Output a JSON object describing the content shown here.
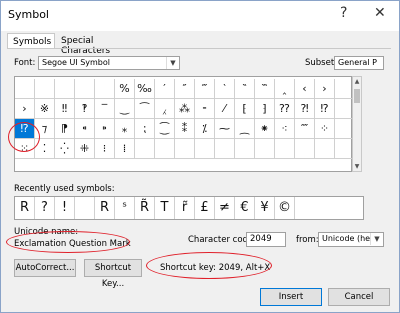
{
  "window": {
    "title": "Symbol",
    "help_glyph": "?",
    "close_glyph": "✕"
  },
  "tabs": [
    {
      "label": "Symbols",
      "active": true
    },
    {
      "label": "Special Characters",
      "active": false
    }
  ],
  "font": {
    "label": "Font:",
    "value": "Segoe UI Symbol"
  },
  "subset": {
    "label": "Subset:",
    "value": "General P"
  },
  "grid": [
    [
      "",
      "",
      "",
      "",
      "",
      "%",
      "‰",
      "′",
      "″",
      "‴",
      "‵",
      "‶",
      "‷",
      "‸",
      "‹",
      "›",
      ""
    ],
    [
      "›",
      "※",
      "‼",
      "‽",
      "‾",
      "‿",
      "⁀",
      "⁁",
      "⁂",
      "⁃",
      "⁄",
      "⁅",
      "⁆",
      "⁇",
      "⁈",
      "⁉",
      ""
    ],
    [
      "⁉",
      "⁊",
      "⁋",
      "⁌",
      "⁍",
      "⁎",
      "⁏",
      "⁐",
      "⁑",
      "⁒",
      "⁓",
      "⁔",
      "⁕",
      "⁖",
      "⁗",
      "⁘",
      ""
    ],
    [
      "⁙",
      "⁚",
      "⁛",
      "⁜",
      "⁝",
      "⁞",
      "",
      "",
      "",
      "",
      "",
      "",
      "",
      "",
      "",
      "",
      ""
    ]
  ],
  "selected_symbol": "⁉",
  "recent": {
    "label": "Recently used symbols:",
    "symbols": [
      "R",
      "?",
      "!",
      "",
      "R",
      "ˢ",
      "R̃",
      "T",
      "r̃",
      "£",
      "≠",
      "€",
      "¥",
      "©"
    ]
  },
  "unicode_name": {
    "label": "Unicode name:",
    "value": "Exclamation Question Mark"
  },
  "character_code": {
    "label": "Character code:",
    "value": "2049"
  },
  "from": {
    "label": "from:",
    "value": "Unicode (hex)"
  },
  "buttons": {
    "autocorrect": "AutoCorrect...",
    "shortcut_key": "Shortcut Key...",
    "insert": "Insert",
    "cancel": "Cancel"
  },
  "shortcut_text": "Shortcut key: 2049, Alt+X",
  "colors": {
    "accent": "#0078d7",
    "annotation": "#e0202a"
  }
}
